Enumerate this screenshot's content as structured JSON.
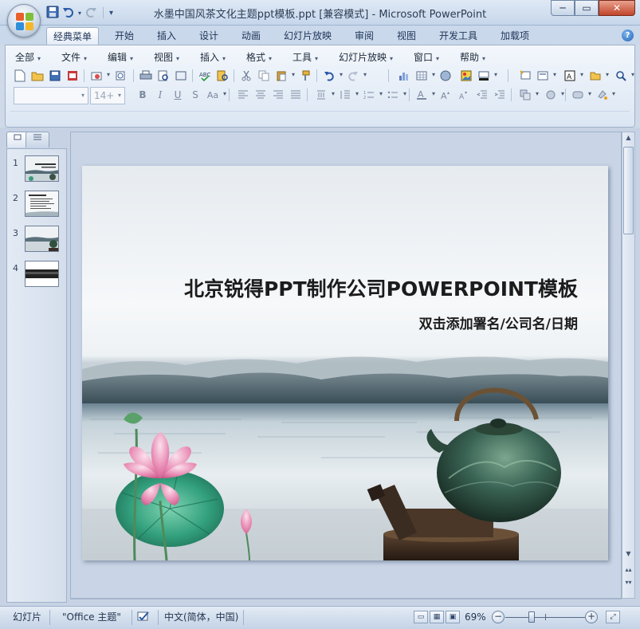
{
  "window": {
    "title": "水墨中国风茶文化主题ppt模板.ppt [兼容模式] - Microsoft PowerPoint",
    "minimize_label": "─",
    "maximize_label": "▭",
    "close_label": "✕"
  },
  "quick_access": {
    "save_icon": "save-icon",
    "undo_icon": "undo-icon",
    "redo_icon": "redo-icon",
    "customize_icon": "customize-icon"
  },
  "ribbon_tabs": [
    "经典菜单",
    "开始",
    "插入",
    "设计",
    "动画",
    "幻灯片放映",
    "审阅",
    "视图",
    "开发工具",
    "加载项"
  ],
  "active_tab": "经典菜单",
  "classic_menu": [
    "全部",
    "文件",
    "编辑",
    "视图",
    "插入",
    "格式",
    "工具",
    "幻灯片放映",
    "窗口",
    "帮助"
  ],
  "font": {
    "name_value": "",
    "size_value": "14+"
  },
  "slides_pane": {
    "tab_slides_icon": "slides-icon",
    "tab_outline_icon": "outline-icon",
    "close_icon": "close-icon",
    "thumbnails": [
      {
        "number": "1",
        "kind": "title-ink"
      },
      {
        "number": "2",
        "kind": "text-list"
      },
      {
        "number": "3",
        "kind": "ink-teapot"
      },
      {
        "number": "4",
        "kind": "dark-band"
      }
    ]
  },
  "slide": {
    "title": "北京锐得PPT制作公司POWERPOINT模板",
    "subtitle": "双击添加署名/公司名/日期"
  },
  "status_bar": {
    "view_label": "幻灯片",
    "theme_label": "\"Office 主题\"",
    "language_label": "中文(简体，中国)",
    "zoom_label": "69%",
    "zoom_percent": 69
  },
  "colors": {
    "ribbon_bg": "#dbe6f3",
    "accent": "#2462b5",
    "slide_sky": "#f1f4f7",
    "mountain": "#3f5560",
    "lotus_pink": "#e48fb5",
    "lotus_leaf": "#3a9a78",
    "teapot_green": "#355a4c"
  }
}
